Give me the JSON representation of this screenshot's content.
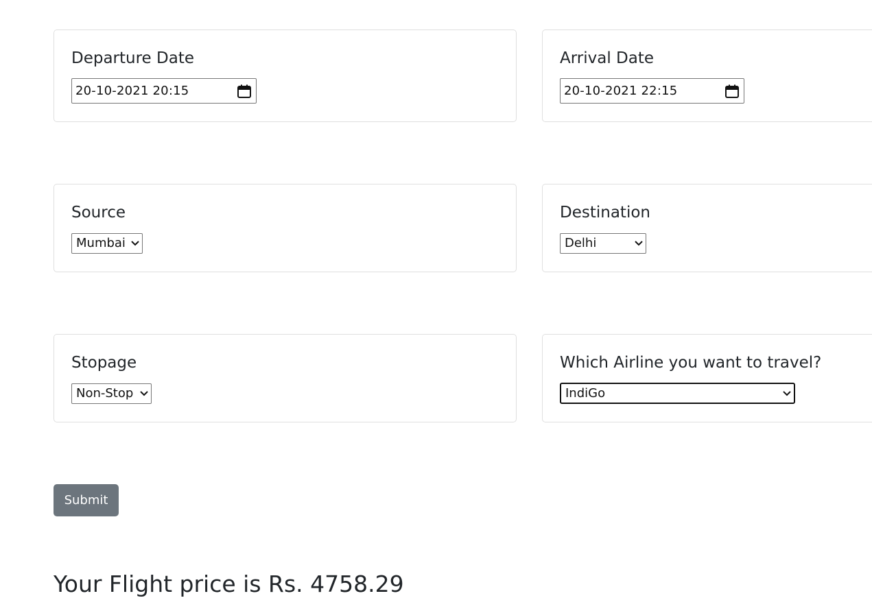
{
  "departure": {
    "label": "Departure Date",
    "value": "20-10-2021 20:15"
  },
  "arrival": {
    "label": "Arrival Date",
    "value": "20-10-2021 22:15"
  },
  "source": {
    "label": "Source",
    "selected": "Mumbai"
  },
  "destination": {
    "label": "Destination",
    "selected": "Delhi"
  },
  "stopage": {
    "label": "Stopage",
    "selected": "Non-Stop"
  },
  "airline": {
    "label": "Which Airline you want to travel?",
    "selected": "IndiGo"
  },
  "submit_label": "Submit",
  "result": "Your Flight price is Rs. 4758.29",
  "icons": {
    "calendar": "calendar-icon",
    "dropdown": "chevron-down-icon"
  },
  "colors": {
    "button": "#6c757d",
    "text": "#212529",
    "card_border": "#dfdfdf"
  }
}
